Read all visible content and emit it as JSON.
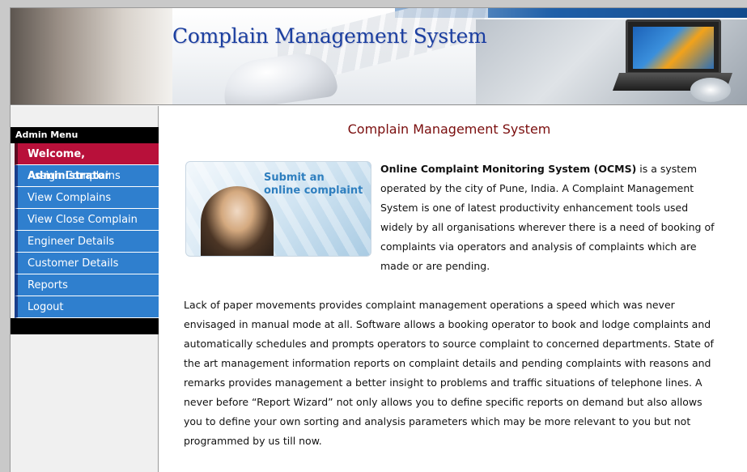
{
  "banner": {
    "title": "Complain Management System"
  },
  "sidebar": {
    "header": "Admin Menu",
    "items": [
      {
        "label": "Welcome, Administrator",
        "active": true
      },
      {
        "label": "Assign Complains"
      },
      {
        "label": "View Complains"
      },
      {
        "label": "View Close Complain"
      },
      {
        "label": "Engineer Details"
      },
      {
        "label": "Customer Details"
      },
      {
        "label": "Reports"
      },
      {
        "label": "Logout"
      }
    ]
  },
  "main": {
    "title": "Complain Management System",
    "promo": {
      "line1": "Submit an",
      "line2": "online complaint"
    },
    "intro_bold": "Online Complaint Monitoring System (OCMS)",
    "intro_rest": " is a system operated by the city of Pune, India. A Complaint Management System is one of latest productivity enhancement tools used widely by all organisations wherever there is a need of booking of complaints via operators and analysis of complaints which are made or are pending.",
    "paragraph2": "Lack of paper movements provides complaint management operations a speed which was never envisaged in manual mode at all. Software allows a booking operator to book and lodge complaints and automatically schedules and prompts operators to source complaint to concerned departments. State of the art management information reports on complaint details and pending complaints with reasons and remarks provides management a better insight to problems and traffic situations of telephone lines. A never before “Report Wizard” not only allows you to define specific reports on demand but also allows you to define your own sorting and analysis parameters which may be more relevant to you but not programmed by us till now."
  },
  "colors": {
    "menu_item": "#2f7fce",
    "menu_active": "#b8103a",
    "title_red": "#7a0d0d",
    "banner_title": "#1b3fa0"
  }
}
